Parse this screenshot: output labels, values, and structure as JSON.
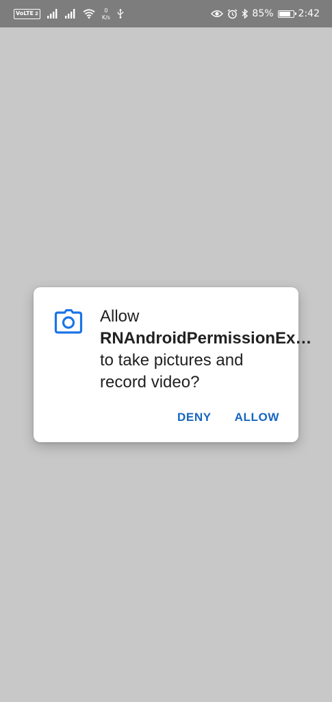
{
  "status_bar": {
    "volte": "VoLTE",
    "sim_slot": "2",
    "net_speed_value": "0",
    "net_speed_unit": "K/s",
    "battery_percent": "85%",
    "battery_level": 0.85,
    "time": "2:42",
    "icons": [
      "volte-icon",
      "signal-icon",
      "signal-icon",
      "wifi-icon",
      "usb-icon",
      "eye-icon",
      "alarm-icon",
      "bluetooth-icon",
      "battery-icon"
    ],
    "icon_color": "#ffffff",
    "background_color": "#7d7d7d"
  },
  "screen": {
    "background_color": "#c8c8c8"
  },
  "permission_dialog": {
    "icon": "camera-icon",
    "accent_color": "#1a73e8",
    "message_prefix": "Allow ",
    "app_name": "RNAndroidPermissionEx…",
    "message_suffix": " to take pictures and record video?",
    "deny_label": "DENY",
    "allow_label": "ALLOW",
    "button_color": "#1565c0"
  }
}
